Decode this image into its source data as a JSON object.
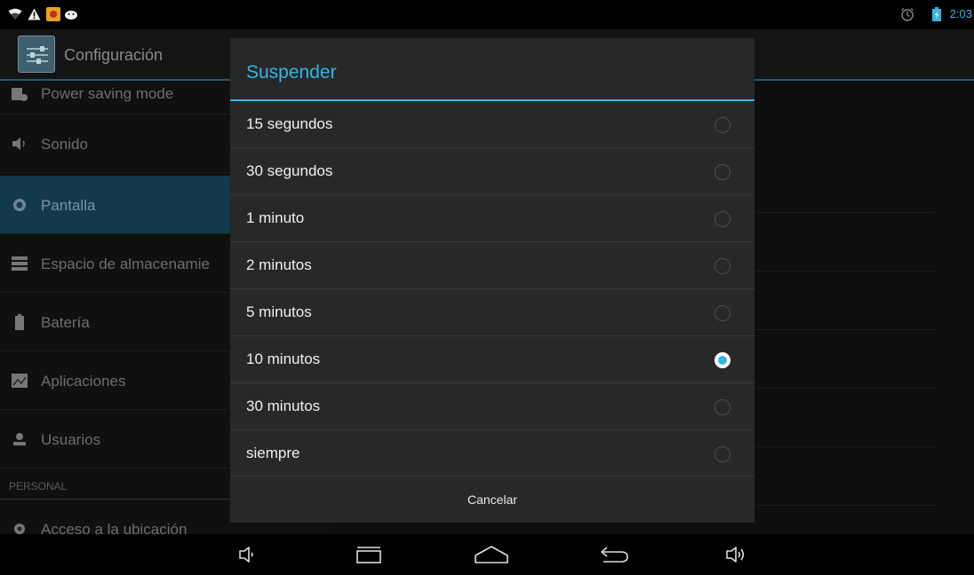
{
  "status_bar": {
    "time": "2:03",
    "icons": [
      "wifi-icon",
      "warning-icon",
      "app-notification-icon",
      "android-icon",
      "alarm-icon",
      "battery-icon"
    ]
  },
  "app": {
    "title": "Configuración"
  },
  "sidebar": {
    "items": [
      {
        "label": "Power saving mode",
        "icon": "power-saving-icon",
        "selected": false
      },
      {
        "label": "Sonido",
        "icon": "speaker-icon",
        "selected": false
      },
      {
        "label": "Pantalla",
        "icon": "display-icon",
        "selected": true
      },
      {
        "label": "Espacio de almacenamie",
        "icon": "storage-icon",
        "selected": false
      },
      {
        "label": "Batería",
        "icon": "battery-icon",
        "selected": false
      },
      {
        "label": "Aplicaciones",
        "icon": "apps-icon",
        "selected": false
      },
      {
        "label": "Usuarios",
        "icon": "user-icon",
        "selected": false
      }
    ],
    "section_header": "PERSONAL",
    "personal_items": [
      {
        "label": "Acceso a la ubicación",
        "icon": "location-icon"
      }
    ]
  },
  "dialog": {
    "title": "Suspender",
    "options": [
      {
        "label": "15 segundos",
        "checked": false
      },
      {
        "label": "30 segundos",
        "checked": false
      },
      {
        "label": "1 minuto",
        "checked": false
      },
      {
        "label": "2 minutos",
        "checked": false
      },
      {
        "label": "5 minutos",
        "checked": false
      },
      {
        "label": "10 minutos",
        "checked": true
      },
      {
        "label": "30 minutos",
        "checked": false
      },
      {
        "label": "siempre",
        "checked": false
      }
    ],
    "cancel_label": "Cancelar"
  },
  "navigation": {
    "buttons": [
      "volume-down-icon",
      "recents-icon",
      "home-icon",
      "back-icon",
      "volume-up-icon"
    ]
  },
  "colors": {
    "accent": "#33b5e5",
    "dialog_bg": "#282828",
    "selected_item_bg": "#123a4a"
  }
}
